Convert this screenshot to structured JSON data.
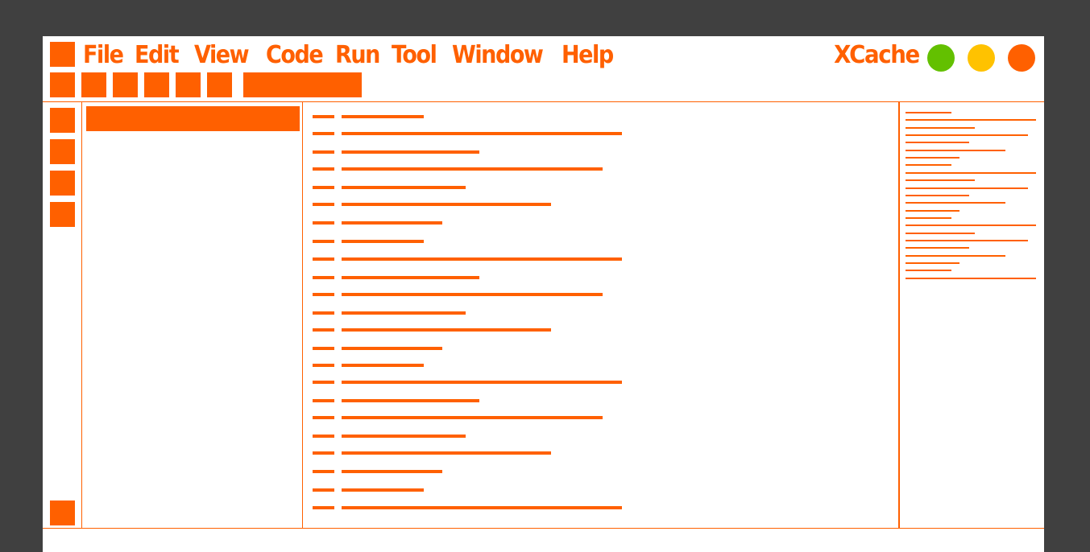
{
  "menu": {
    "items": [
      "File",
      "Edit",
      "View",
      "Code",
      "Run",
      "Tool",
      "Window",
      "Help"
    ]
  },
  "app_title": "XCache",
  "window_controls": {
    "colors": [
      "#63c000",
      "#ffc200",
      "#ff6000"
    ]
  },
  "theme": {
    "accent": "#ff6000",
    "background": "#404040",
    "panel": "#ffffff"
  }
}
